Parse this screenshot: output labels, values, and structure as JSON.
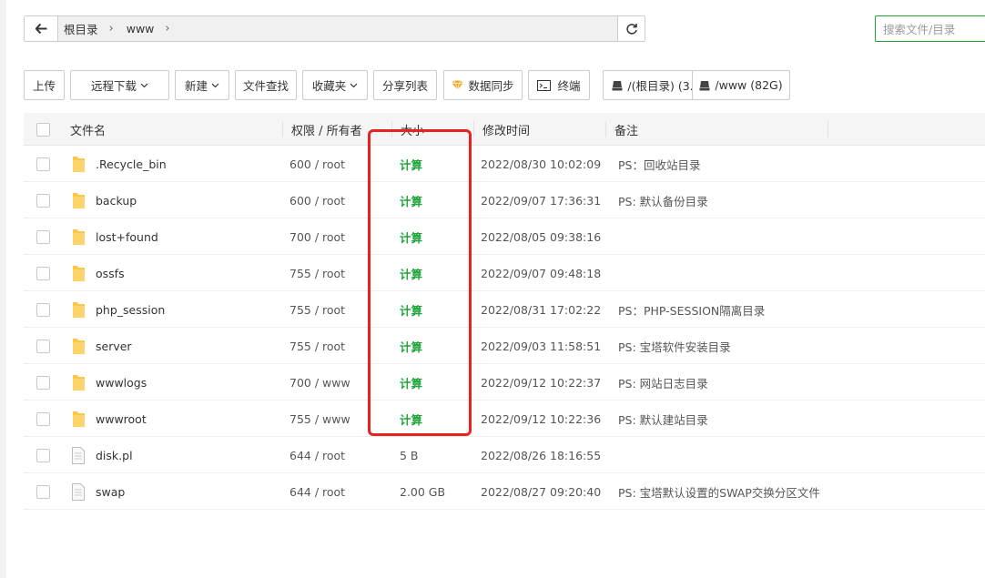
{
  "path": {
    "crumbs": [
      "根目录",
      "www"
    ]
  },
  "search": {
    "placeholder": "搜索文件/目录"
  },
  "toolbar": {
    "upload": "上传",
    "remote_download": "远程下载",
    "new": "新建",
    "find_file": "文件查找",
    "favorites": "收藏夹",
    "share_list": "分享列表",
    "data_sync": "数据同步",
    "terminal": "终端",
    "disk_root": "/(根目录) (3...",
    "disk_www": "/www (82G)"
  },
  "table": {
    "headers": {
      "name": "文件名",
      "perm": "权限 / 所有者",
      "size": "大小",
      "mtime": "修改时间",
      "note": "备注"
    },
    "rows": [
      {
        "type": "folder",
        "name": ".Recycle_bin",
        "perm": "600 / root",
        "size": "计算",
        "mtime": "2022/08/30 10:02:09",
        "note": "PS：回收站目录"
      },
      {
        "type": "folder",
        "name": "backup",
        "perm": "600 / root",
        "size": "计算",
        "mtime": "2022/09/07 17:36:31",
        "note": "PS: 默认备份目录"
      },
      {
        "type": "folder",
        "name": "lost+found",
        "perm": "700 / root",
        "size": "计算",
        "mtime": "2022/08/05 09:38:16",
        "note": ""
      },
      {
        "type": "folder",
        "name": "ossfs",
        "perm": "755 / root",
        "size": "计算",
        "mtime": "2022/09/07 09:48:18",
        "note": ""
      },
      {
        "type": "folder",
        "name": "php_session",
        "perm": "755 / root",
        "size": "计算",
        "mtime": "2022/08/31 17:02:22",
        "note": "PS：PHP-SESSION隔离目录"
      },
      {
        "type": "folder",
        "name": "server",
        "perm": "755 / root",
        "size": "计算",
        "mtime": "2022/09/03 11:58:51",
        "note": "PS: 宝塔软件安装目录"
      },
      {
        "type": "folder",
        "name": "wwwlogs",
        "perm": "700 / www",
        "size": "计算",
        "mtime": "2022/09/12 10:22:37",
        "note": "PS: 网站日志目录"
      },
      {
        "type": "folder",
        "name": "wwwroot",
        "perm": "755 / www",
        "size": "计算",
        "mtime": "2022/09/12 10:22:36",
        "note": "PS: 默认建站目录"
      },
      {
        "type": "file",
        "name": "disk.pl",
        "perm": "644 / root",
        "size": "5 B",
        "mtime": "2022/08/26 18:16:55",
        "note": ""
      },
      {
        "type": "file",
        "name": "swap",
        "perm": "644 / root",
        "size": "2.00 GB",
        "mtime": "2022/08/27 09:20:40",
        "note": "PS: 宝塔默认设置的SWAP交换分区文件"
      }
    ]
  },
  "colors": {
    "accent_green": "#20a53a",
    "highlight_red": "#e8231f",
    "folder_yellow": "#f7c84b"
  }
}
